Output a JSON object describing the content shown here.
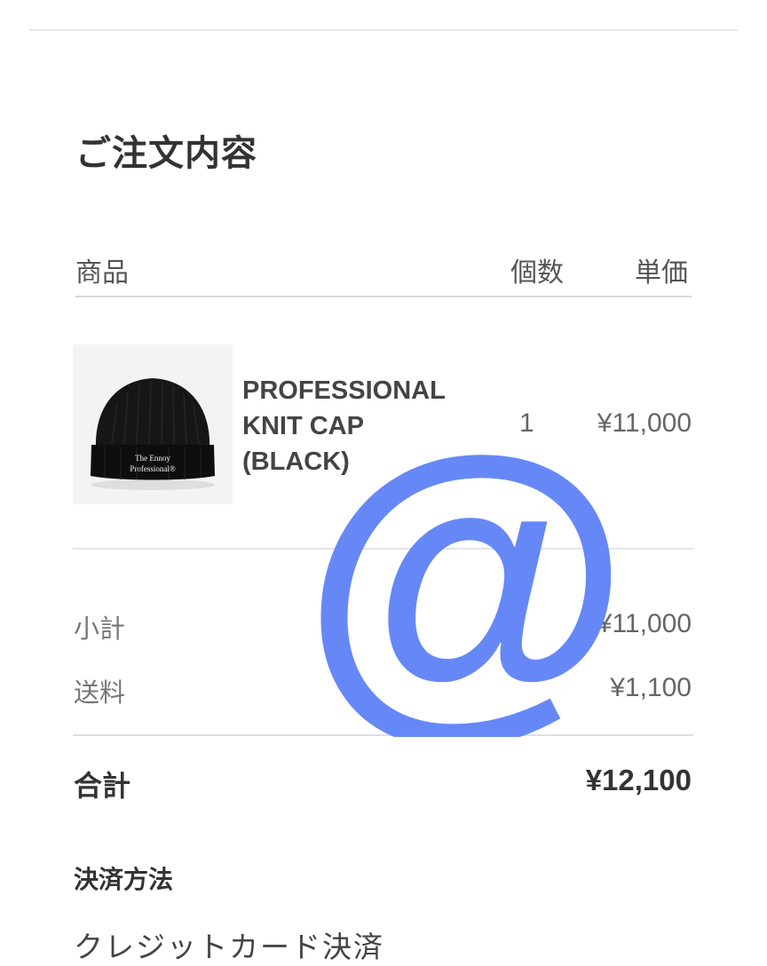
{
  "order": {
    "title": "ご注文内容",
    "columns": {
      "product": "商品",
      "quantity": "個数",
      "unit_price": "単価"
    },
    "items": [
      {
        "name": "PROFESSIONAL\nKNIT CAP\n(BLACK)",
        "quantity": "1",
        "unit_price": "¥11,000",
        "image": {
          "type": "black knit beanie",
          "label_line1": "The Ennoy",
          "label_line2": "Professional®"
        }
      }
    ],
    "summary": {
      "subtotal_label": "小計",
      "subtotal_value": "¥11,000",
      "shipping_label": "送料",
      "shipping_value": "¥1,100",
      "total_label": "合計",
      "total_value": "¥12,100"
    },
    "payment": {
      "heading": "決済方法",
      "method": "クレジットカード決済"
    }
  },
  "overlay": {
    "glyph": "@",
    "color": "#6688f7"
  },
  "colors": {
    "text_primary": "#333333",
    "text_secondary": "#666666",
    "divider": "#dcdfe3"
  }
}
